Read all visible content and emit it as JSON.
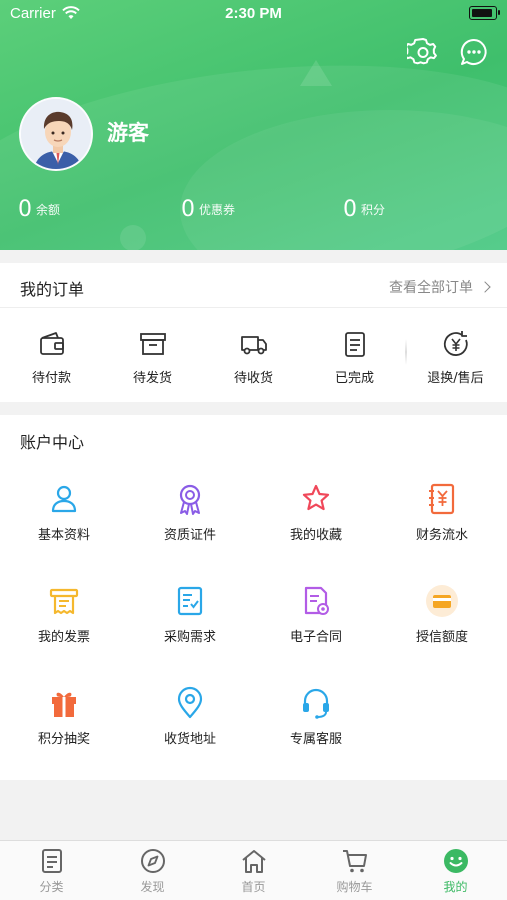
{
  "status_bar": {
    "carrier": "Carrier",
    "time": "2:30 PM"
  },
  "profile": {
    "username": "游客",
    "stats": [
      {
        "value": "0",
        "label": "余额"
      },
      {
        "value": "0",
        "label": "优惠券"
      },
      {
        "value": "0",
        "label": "积分"
      }
    ]
  },
  "orders": {
    "title": "我的订单",
    "view_all": "查看全部订单",
    "items": [
      {
        "label": "待付款",
        "icon": "wallet-icon"
      },
      {
        "label": "待发货",
        "icon": "box-icon"
      },
      {
        "label": "待收货",
        "icon": "truck-icon"
      },
      {
        "label": "已完成",
        "icon": "clipboard-icon"
      },
      {
        "label": "退换/售后",
        "icon": "refund-icon"
      }
    ]
  },
  "account": {
    "title": "账户中心",
    "items": [
      {
        "label": "基本资料",
        "icon": "user-icon",
        "color": "#2aa7e8"
      },
      {
        "label": "资质证件",
        "icon": "award-icon",
        "color": "#8a5ce6"
      },
      {
        "label": "我的收藏",
        "icon": "star-icon",
        "color": "#f0485a"
      },
      {
        "label": "财务流水",
        "icon": "ledger-icon",
        "color": "#f26a3c"
      },
      {
        "label": "我的发票",
        "icon": "invoice-icon",
        "color": "#f5b82e"
      },
      {
        "label": "采购需求",
        "icon": "purchase-list-icon",
        "color": "#2aa7e8"
      },
      {
        "label": "电子合同",
        "icon": "contract-icon",
        "color": "#b25ce6"
      },
      {
        "label": "授信额度",
        "icon": "credit-card-icon",
        "color": "#f5a623"
      },
      {
        "label": "积分抽奖",
        "icon": "gift-icon",
        "color": "#f26a3c"
      },
      {
        "label": "收货地址",
        "icon": "location-icon",
        "color": "#2aa7e8"
      },
      {
        "label": "专属客服",
        "icon": "headset-icon",
        "color": "#2aa7e8"
      }
    ]
  },
  "tabbar": {
    "items": [
      {
        "label": "分类",
        "icon": "category-icon"
      },
      {
        "label": "发现",
        "icon": "compass-icon"
      },
      {
        "label": "首页",
        "icon": "home-icon"
      },
      {
        "label": "购物车",
        "icon": "cart-icon"
      },
      {
        "label": "我的",
        "icon": "smile-icon"
      }
    ],
    "active_index": 4,
    "active_color": "#3bb963",
    "inactive_color": "#999999"
  },
  "colors": {
    "header_green": "#44c36f",
    "page_bg": "#f2f2f2"
  }
}
